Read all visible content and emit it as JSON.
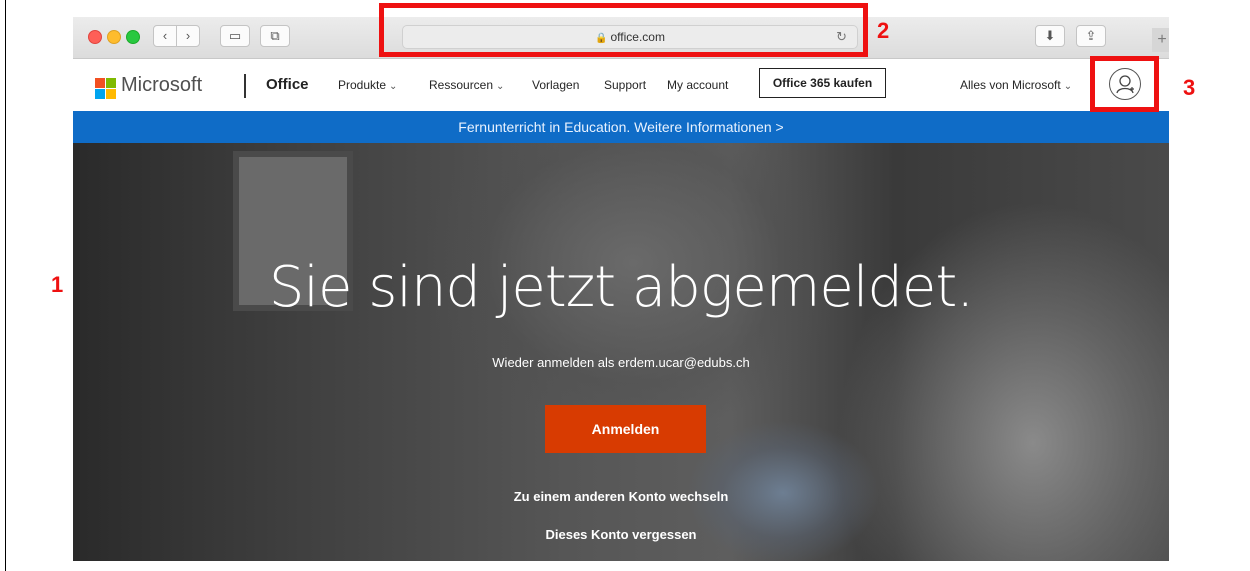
{
  "browser": {
    "url": "office.com",
    "back_icon": "‹",
    "forward_icon": "›",
    "sidebar_icon": "▭",
    "tabs_icon": "⧉",
    "lock_icon": "🔒",
    "reload_icon": "↻",
    "download_icon": "⬇",
    "share_icon": "⇪",
    "new_tab_icon": "+"
  },
  "nav": {
    "brand": "Microsoft",
    "product": "Office",
    "links": [
      "Produkte",
      "Ressourcen",
      "Vorlagen",
      "Support",
      "My account"
    ],
    "chevron": "⌄",
    "buy_label": "Office 365 kaufen",
    "all_microsoft": "Alles von Microsoft"
  },
  "banner": {
    "text": "Fernunterricht in Education. Weitere Informationen >"
  },
  "hero": {
    "title": "Sie sind jetzt abgemeldet.",
    "subtitle": "Wieder anmelden als erdem.ucar@edubs.ch",
    "signin_label": "Anmelden",
    "switch_account": "Zu einem anderen Konto wechseln",
    "forget_account": "Dieses Konto vergessen"
  },
  "annotations": {
    "label_1": "1",
    "label_2": "2",
    "label_3": "3"
  },
  "colors": {
    "annotation_red": "#ee1111",
    "banner_blue": "#0f6cc7",
    "signin_orange": "#d83b01"
  }
}
